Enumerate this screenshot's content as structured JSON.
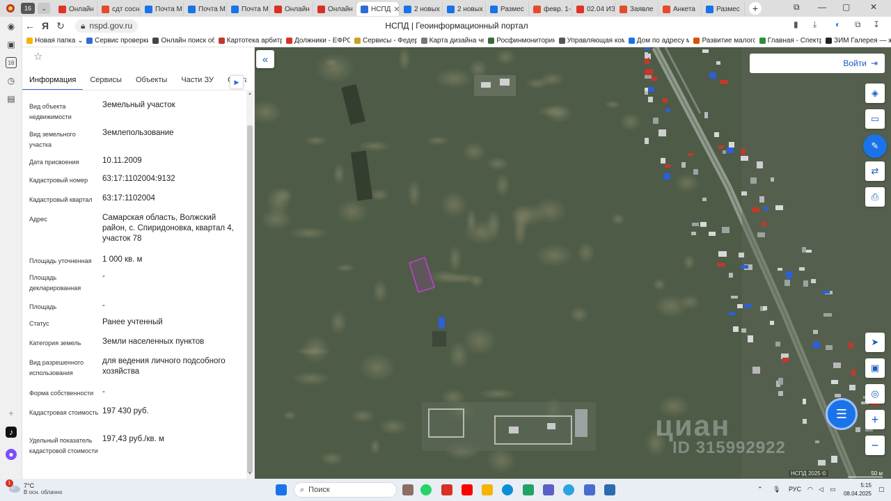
{
  "browser": {
    "profile_badge": "16",
    "tabs": [
      {
        "label": "Онлайн",
        "color": "#e0342a"
      },
      {
        "label": "сдт сосн",
        "color": "#e54b2a"
      },
      {
        "label": "Почта М",
        "color": "#1a73e8"
      },
      {
        "label": "Почта М",
        "color": "#1a73e8"
      },
      {
        "label": "Почта М",
        "color": "#1a73e8"
      },
      {
        "label": "Онлайн",
        "color": "#d93025"
      },
      {
        "label": "Онлайн",
        "color": "#d93025"
      },
      {
        "label": "НСПД",
        "color": "#2e6bd6",
        "active": true
      },
      {
        "label": "2 новых",
        "color": "#1a73e8"
      },
      {
        "label": "2 новых",
        "color": "#1a73e8"
      },
      {
        "label": "Размес",
        "color": "#1a73e8"
      },
      {
        "label": "февр. 1-",
        "color": "#e54b2a"
      },
      {
        "label": "02.04 ИЗ",
        "color": "#e0342a"
      },
      {
        "label": "Заявле",
        "color": "#e54b2a"
      },
      {
        "label": "Анкета",
        "color": "#e54b2a"
      },
      {
        "label": "Размес",
        "color": "#1a73e8"
      }
    ],
    "url": "nspd.gov.ru",
    "page_title": "НСПД | Геоинформационный портал",
    "bookmarks": [
      {
        "label": "Новая папка",
        "color": "#f4b400"
      },
      {
        "label": "Сервис проверки",
        "color": "#2e6bd6"
      },
      {
        "label": "Онлайн поиск об",
        "color": "#444444"
      },
      {
        "label": "Картотека арбитр",
        "color": "#c0392b"
      },
      {
        "label": "Должники - ЕФРС",
        "color": "#d93025"
      },
      {
        "label": "Сервисы - Федер",
        "color": "#c9a227"
      },
      {
        "label": "Карта дизайна че",
        "color": "#777777"
      },
      {
        "label": "Росфинмониторин",
        "color": "#3b6b3b"
      },
      {
        "label": "Управляющая ком",
        "color": "#555555"
      },
      {
        "label": "Дом по адресу м",
        "color": "#1a73e8"
      },
      {
        "label": "Развитие малого",
        "color": "#d35400"
      },
      {
        "label": "Главная - Спектр",
        "color": "#2d8f3c"
      },
      {
        "label": "ЗИМ Галерея — ж",
        "color": "#222222"
      }
    ]
  },
  "panel": {
    "tabs": [
      "Информация",
      "Сервисы",
      "Объекты",
      "Части ЗУ",
      "Соста"
    ],
    "active_tab": 0,
    "rows": [
      {
        "label": "Вид объекта недвижимости",
        "value": "Земельный участок"
      },
      {
        "label": "Вид земельного участка",
        "value": "Землепользование"
      },
      {
        "label": "Дата присвоения",
        "value": "10.11.2009"
      },
      {
        "label": "Кадастровый номер",
        "value": "63:17:1102004:9132"
      },
      {
        "label": "Кадастровый квартал",
        "value": "63:17:1102004"
      },
      {
        "label": "Адрес",
        "value": "Самарская область, Волжский район, с. Спиридоновка, квартал 4, участок 78"
      },
      {
        "label": "Площадь уточненная",
        "value": "1 000 кв. м"
      },
      {
        "label": "Площадь декларированная",
        "value": "-"
      },
      {
        "label": "Площадь",
        "value": "-"
      },
      {
        "label": "Статус",
        "value": "Ранее учтенный"
      },
      {
        "label": "Категория земель",
        "value": "Земли населенных пунктов"
      },
      {
        "label": "Вид разрешенного использования",
        "value": "для ведения личного подсобного хозяйства"
      },
      {
        "label": "Форма собственности",
        "value": "-"
      },
      {
        "label": "Кадастровая стоимость",
        "value": "197 430 руб."
      },
      {
        "label": "Удельный показатель кадастровой стоимости",
        "value": "197,43 руб./кв. м"
      }
    ]
  },
  "map": {
    "login_label": "Войти",
    "watermark": "циан",
    "watermark_id": "ID 315992922",
    "attribution": "НСПД 2025 ©",
    "scale_label": "50 м",
    "parcel_color": "#c23fd1"
  },
  "taskbar": {
    "weather_temp": "7°C",
    "weather_desc": "В осн. облачно",
    "notification_count": "1",
    "search_placeholder": "Поиск",
    "language": "РУС",
    "time": "5:15",
    "date": "08.04.2025"
  }
}
